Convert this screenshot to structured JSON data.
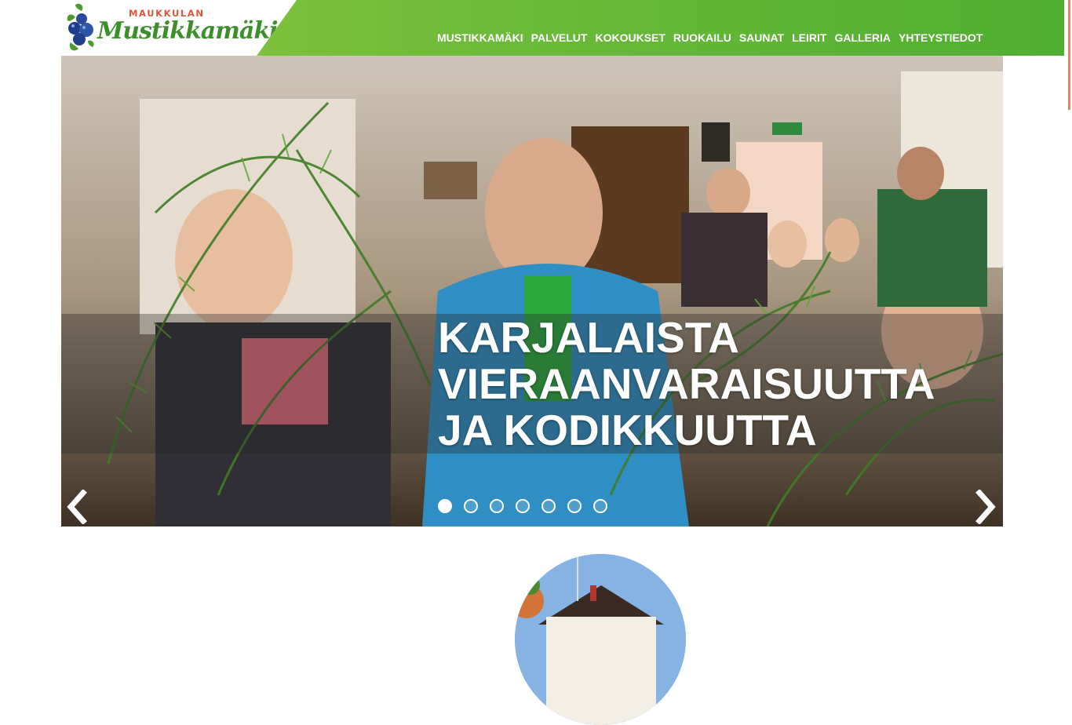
{
  "brand": {
    "small": "MAUKKULAN",
    "script": "Mustikkamäki"
  },
  "nav": {
    "items": [
      {
        "label": "MUSTIKKAMÄKI"
      },
      {
        "label": "PALVELUT"
      },
      {
        "label": "KOKOUKSET"
      },
      {
        "label": "RUOKAILU"
      },
      {
        "label": "SAUNAT"
      },
      {
        "label": "LEIRIT"
      },
      {
        "label": "GALLERIA"
      },
      {
        "label": "YHTEYSTIEDOT"
      }
    ]
  },
  "slider": {
    "caption_lines": [
      "KARJALAISTA",
      "VIERAANVARAISUUTTA",
      "JA KODIKKUUTTA"
    ],
    "active_index": 0,
    "dot_count": 7,
    "prev_icon": "chevron-left-icon",
    "next_icon": "chevron-right-icon"
  },
  "colors": {
    "header_green": "#6fbb3a",
    "logo_orange": "#d9573a",
    "logo_green": "#3c8f2b"
  }
}
